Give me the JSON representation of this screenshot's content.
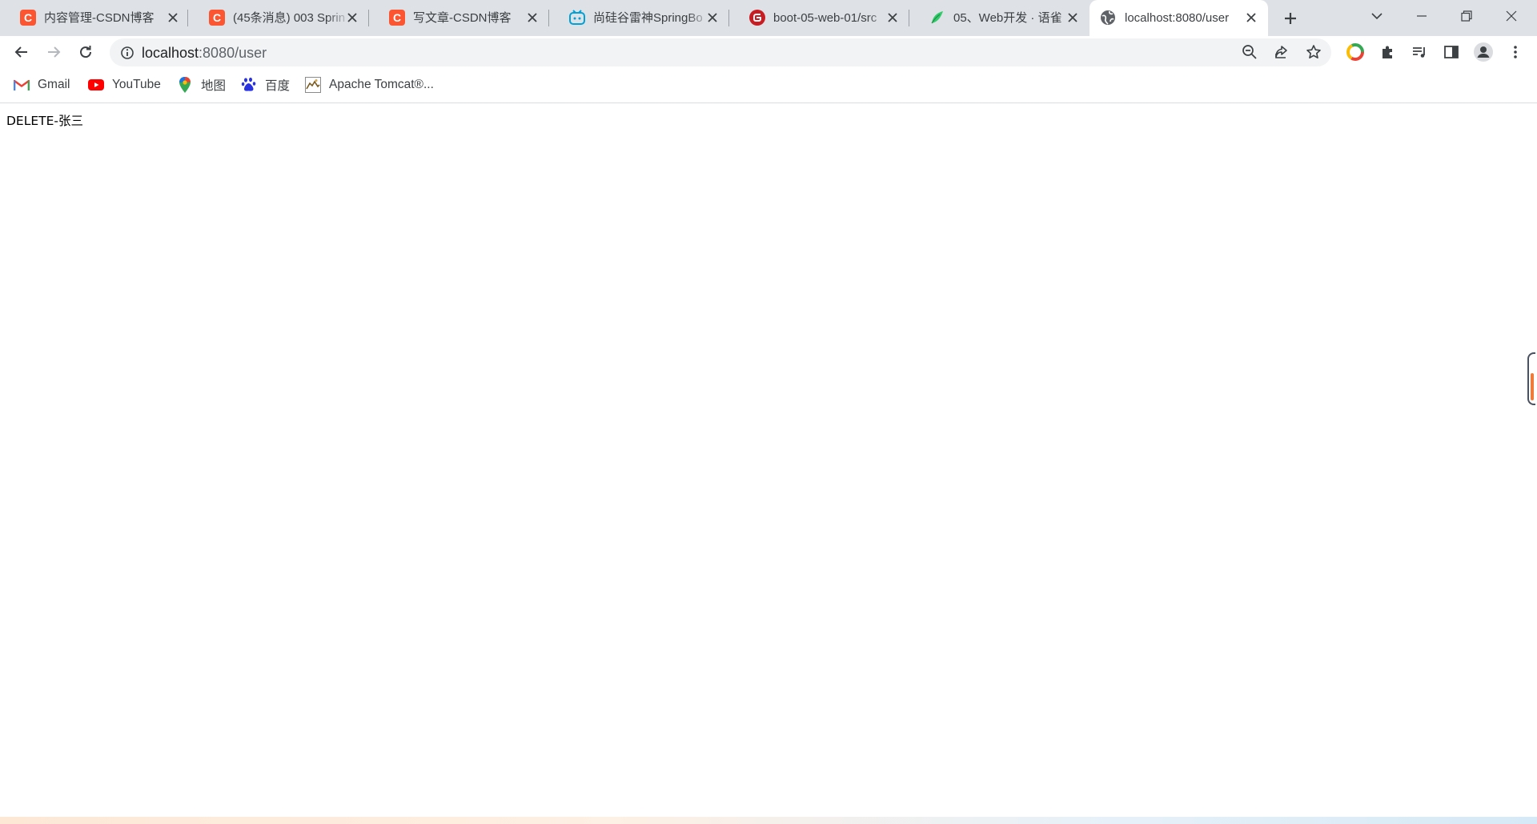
{
  "tabs": [
    {
      "title": "内容管理-CSDN博客",
      "favicon": "csdn-icon",
      "color": "#fc5531"
    },
    {
      "title": "(45条消息) 003 Sprin",
      "favicon": "csdn-icon",
      "color": "#fc5531"
    },
    {
      "title": "写文章-CSDN博客",
      "favicon": "csdn-icon",
      "color": "#fc5531"
    },
    {
      "title": "尚硅谷雷神SpringBo",
      "favicon": "bilibili-icon",
      "color": "#00a1d6"
    },
    {
      "title": "boot-05-web-01/src",
      "favicon": "gitee-icon",
      "color": "#c71d23"
    },
    {
      "title": "05、Web开发 · 语雀",
      "favicon": "yuque-icon",
      "color": "#31cc6a"
    },
    {
      "title": "localhost:8080/user",
      "favicon": "globe-icon",
      "active": true
    }
  ],
  "address": {
    "host": "localhost",
    "path": ":8080/user"
  },
  "bookmarks": [
    {
      "label": "Gmail",
      "icon": "gmail-icon"
    },
    {
      "label": "YouTube",
      "icon": "youtube-icon"
    },
    {
      "label": "地图",
      "icon": "maps-icon"
    },
    {
      "label": "百度",
      "icon": "baidu-icon"
    },
    {
      "label": "Apache Tomcat®...",
      "icon": "tomcat-icon"
    }
  ],
  "page": {
    "response_text": "DELETE-张三"
  }
}
